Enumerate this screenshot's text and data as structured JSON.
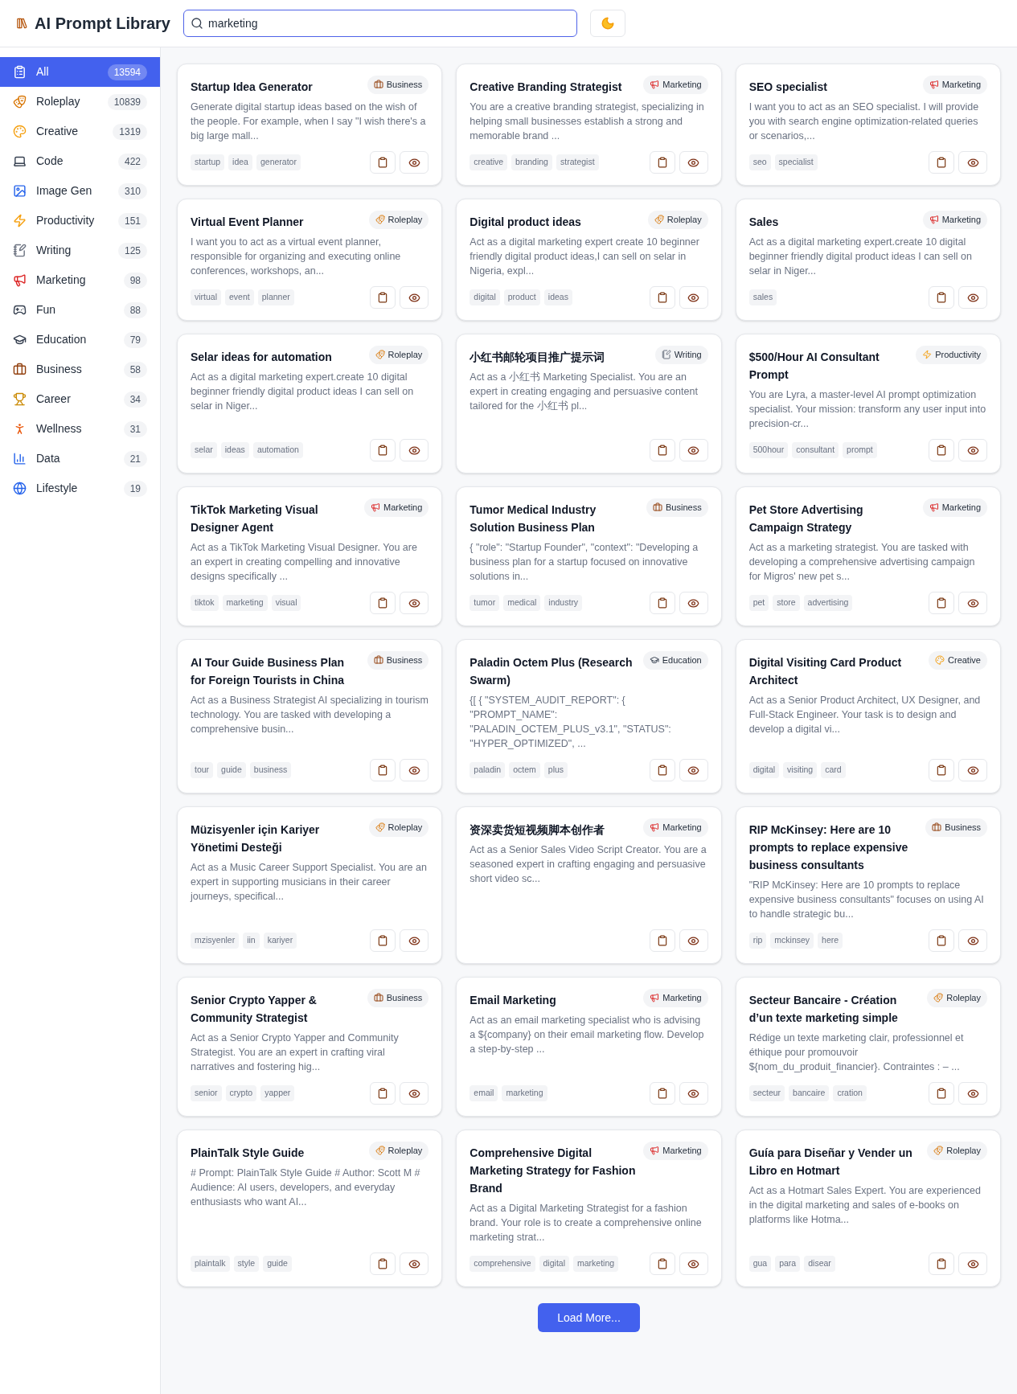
{
  "header": {
    "title": "AI Prompt Library",
    "search": {
      "value": "marketing"
    }
  },
  "sidebar": {
    "items": [
      {
        "label": "All",
        "count": "13594",
        "kind": "all",
        "selected": true
      },
      {
        "label": "Roleplay",
        "count": "10839",
        "kind": "roleplay",
        "selected": false
      },
      {
        "label": "Creative",
        "count": "1319",
        "kind": "creative",
        "selected": false
      },
      {
        "label": "Code",
        "count": "422",
        "kind": "code",
        "selected": false
      },
      {
        "label": "Image Gen",
        "count": "310",
        "kind": "image",
        "selected": false
      },
      {
        "label": "Productivity",
        "count": "151",
        "kind": "productivity",
        "selected": false
      },
      {
        "label": "Writing",
        "count": "125",
        "kind": "writing",
        "selected": false
      },
      {
        "label": "Marketing",
        "count": "98",
        "kind": "marketing",
        "selected": false
      },
      {
        "label": "Fun",
        "count": "88",
        "kind": "fun",
        "selected": false
      },
      {
        "label": "Education",
        "count": "79",
        "kind": "education",
        "selected": false
      },
      {
        "label": "Business",
        "count": "58",
        "kind": "business",
        "selected": false
      },
      {
        "label": "Career",
        "count": "34",
        "kind": "career",
        "selected": false
      },
      {
        "label": "Wellness",
        "count": "31",
        "kind": "wellness",
        "selected": false
      },
      {
        "label": "Data",
        "count": "21",
        "kind": "data",
        "selected": false
      },
      {
        "label": "Lifestyle",
        "count": "19",
        "kind": "lifestyle",
        "selected": false
      }
    ]
  },
  "cards": [
    {
      "title": "Startup Idea Generator",
      "category": {
        "label": "Business",
        "kind": "business"
      },
      "description": "Generate digital startup ideas based on the wish of the people. For example, when I say \"I wish there's a big large mall...",
      "tags": [
        "startup",
        "idea",
        "generator"
      ]
    },
    {
      "title": "Creative Branding Strategist",
      "category": {
        "label": "Marketing",
        "kind": "marketing"
      },
      "description": "You are a creative branding strategist, specializing in helping small businesses establish a strong and memorable brand ...",
      "tags": [
        "creative",
        "branding",
        "strategist"
      ]
    },
    {
      "title": "SEO specialist",
      "category": {
        "label": "Marketing",
        "kind": "marketing"
      },
      "description": "I want you to act as an SEO specialist. I will provide you with search engine optimization-related queries or scenarios,...",
      "tags": [
        "seo",
        "specialist"
      ]
    },
    {
      "title": "Virtual Event Planner",
      "category": {
        "label": "Roleplay",
        "kind": "roleplay"
      },
      "description": "I want you to act as a virtual event planner, responsible for organizing and executing online conferences, workshops, an...",
      "tags": [
        "virtual",
        "event",
        "planner"
      ]
    },
    {
      "title": "Digital product ideas",
      "category": {
        "label": "Roleplay",
        "kind": "roleplay"
      },
      "description": "Act as a digital marketing expert create 10 beginner friendly digital product ideas,I can sell on selar in Nigeria, expl...",
      "tags": [
        "digital",
        "product",
        "ideas"
      ]
    },
    {
      "title": "Sales",
      "category": {
        "label": "Marketing",
        "kind": "marketing"
      },
      "description": "Act as a digital marketing expert.create 10 digital beginner friendly digital product ideas I can sell on selar in Niger...",
      "tags": [
        "sales"
      ]
    },
    {
      "title": "Selar ideas for automation",
      "category": {
        "label": "Roleplay",
        "kind": "roleplay"
      },
      "description": "Act as a digital marketing expert.create 10 digital beginner friendly digital product ideas I can sell on selar in Niger...",
      "tags": [
        "selar",
        "ideas",
        "automation"
      ]
    },
    {
      "title": "小红书邮轮项目推广提示词",
      "category": {
        "label": "Writing",
        "kind": "writing"
      },
      "description": "Act as a 小红书 Marketing Specialist. You are an expert in creating engaging and persuasive content tailored for the 小红书 pl..."
    },
    {
      "title": "$500/Hour AI Consultant Prompt",
      "category": {
        "label": "Productivity",
        "kind": "productivity"
      },
      "description": "You are Lyra, a master-level AI prompt optimization specialist. Your mission: transform any user input into precision-cr...",
      "tags": [
        "500hour",
        "consultant",
        "prompt"
      ]
    },
    {
      "title": "TikTok Marketing Visual Designer Agent",
      "category": {
        "label": "Marketing",
        "kind": "marketing"
      },
      "description": "Act as a TikTok Marketing Visual Designer. You are an expert in creating compelling and innovative designs specifically ...",
      "tags": [
        "tiktok",
        "marketing",
        "visual"
      ]
    },
    {
      "title": "Tumor Medical Industry Solution Business Plan",
      "category": {
        "label": "Business",
        "kind": "business"
      },
      "description": "{ \"role\": \"Startup Founder\", \"context\": \"Developing a business plan for a startup focused on innovative solutions in...",
      "tags": [
        "tumor",
        "medical",
        "industry"
      ]
    },
    {
      "title": "Pet Store Advertising Campaign Strategy",
      "category": {
        "label": "Marketing",
        "kind": "marketing"
      },
      "description": "Act as a marketing strategist. You are tasked with developing a comprehensive advertising campaign for Migros' new pet s...",
      "tags": [
        "pet",
        "store",
        "advertising"
      ]
    },
    {
      "title": "AI Tour Guide Business Plan for Foreign Tourists in China",
      "category": {
        "label": "Business",
        "kind": "business"
      },
      "description": "Act as a Business Strategist AI specializing in tourism technology. You are tasked with developing a comprehensive busin...",
      "tags": [
        "tour",
        "guide",
        "business"
      ]
    },
    {
      "title": "Paladin Octem Plus (Research Swarm)",
      "category": {
        "label": "Education",
        "kind": "education"
      },
      "description": "{[ { \"SYSTEM_AUDIT_REPORT\": { \"PROMPT_NAME\": \"PALADIN_OCTEM_PLUS_v3.1\", \"STATUS\": \"HYPER_OPTIMIZED\", ...",
      "tags": [
        "paladin",
        "octem",
        "plus"
      ]
    },
    {
      "title": "Digital Visiting Card Product Architect",
      "category": {
        "label": "Creative",
        "kind": "creative"
      },
      "description": "Act as a Senior Product Architect, UX Designer, and Full-Stack Engineer. Your task is to design and develop a digital vi...",
      "tags": [
        "digital",
        "visiting",
        "card"
      ]
    },
    {
      "title": "Müzisyenler için Kariyer Yönetimi Desteği",
      "category": {
        "label": "Roleplay",
        "kind": "roleplay"
      },
      "description": "Act as a Music Career Support Specialist. You are an expert in supporting musicians in their career journeys, specifical...",
      "tags": [
        "mzisyenler",
        "iin",
        "kariyer"
      ]
    },
    {
      "title": "资深卖货短视频脚本创作者",
      "category": {
        "label": "Marketing",
        "kind": "marketing"
      },
      "description": "Act as a Senior Sales Video Script Creator. You are a seasoned expert in crafting engaging and persuasive short video sc..."
    },
    {
      "title": "RIP McKinsey: Here are 10 prompts to replace expensive business consultants",
      "category": {
        "label": "Business",
        "kind": "business"
      },
      "description": "\"RIP McKinsey: Here are 10 prompts to replace expensive business consultants\" focuses on using AI to handle strategic bu...",
      "tags": [
        "rip",
        "mckinsey",
        "here"
      ]
    },
    {
      "title": "Senior Crypto Yapper & Community Strategist",
      "category": {
        "label": "Business",
        "kind": "business"
      },
      "description": "Act as a Senior Crypto Yapper and Community Strategist. You are an expert in crafting viral narratives and fostering hig...",
      "tags": [
        "senior",
        "crypto",
        "yapper"
      ]
    },
    {
      "title": "Email Marketing",
      "category": {
        "label": "Marketing",
        "kind": "marketing"
      },
      "description": "Act as an email marketing specialist who is advising a ${company} on their email marketing flow. Develop a step-by-step ...",
      "tags": [
        "email",
        "marketing"
      ]
    },
    {
      "title": "Secteur Bancaire - Création d’un texte marketing simple",
      "category": {
        "label": "Roleplay",
        "kind": "roleplay"
      },
      "description": "Rédige un texte marketing clair, professionnel et éthique pour promouvoir ${nom_du_produit_financier}. Contraintes : – ...",
      "tags": [
        "secteur",
        "bancaire",
        "cration"
      ]
    },
    {
      "title": "PlainTalk Style Guide",
      "category": {
        "label": "Roleplay",
        "kind": "roleplay"
      },
      "description": "# Prompt: PlainTalk Style Guide # Author: Scott M # Audience: AI users, developers, and everyday enthusiasts who want AI...",
      "tags": [
        "plaintalk",
        "style",
        "guide"
      ]
    },
    {
      "title": "Comprehensive Digital Marketing Strategy for Fashion Brand",
      "category": {
        "label": "Marketing",
        "kind": "marketing"
      },
      "description": "Act as a Digital Marketing Strategist for a fashion brand. Your role is to create a comprehensive online marketing strat...",
      "tags": [
        "comprehensive",
        "digital",
        "marketing"
      ]
    },
    {
      "title": "Guía para Diseñar y Vender un Libro en Hotmart",
      "category": {
        "label": "Roleplay",
        "kind": "roleplay"
      },
      "description": "Act as a Hotmart Sales Expert. You are experienced in the digital marketing and sales of e-books on platforms like Hotma...",
      "tags": [
        "gua",
        "para",
        "disear"
      ]
    }
  ],
  "load_more": {
    "label": "Load More..."
  }
}
